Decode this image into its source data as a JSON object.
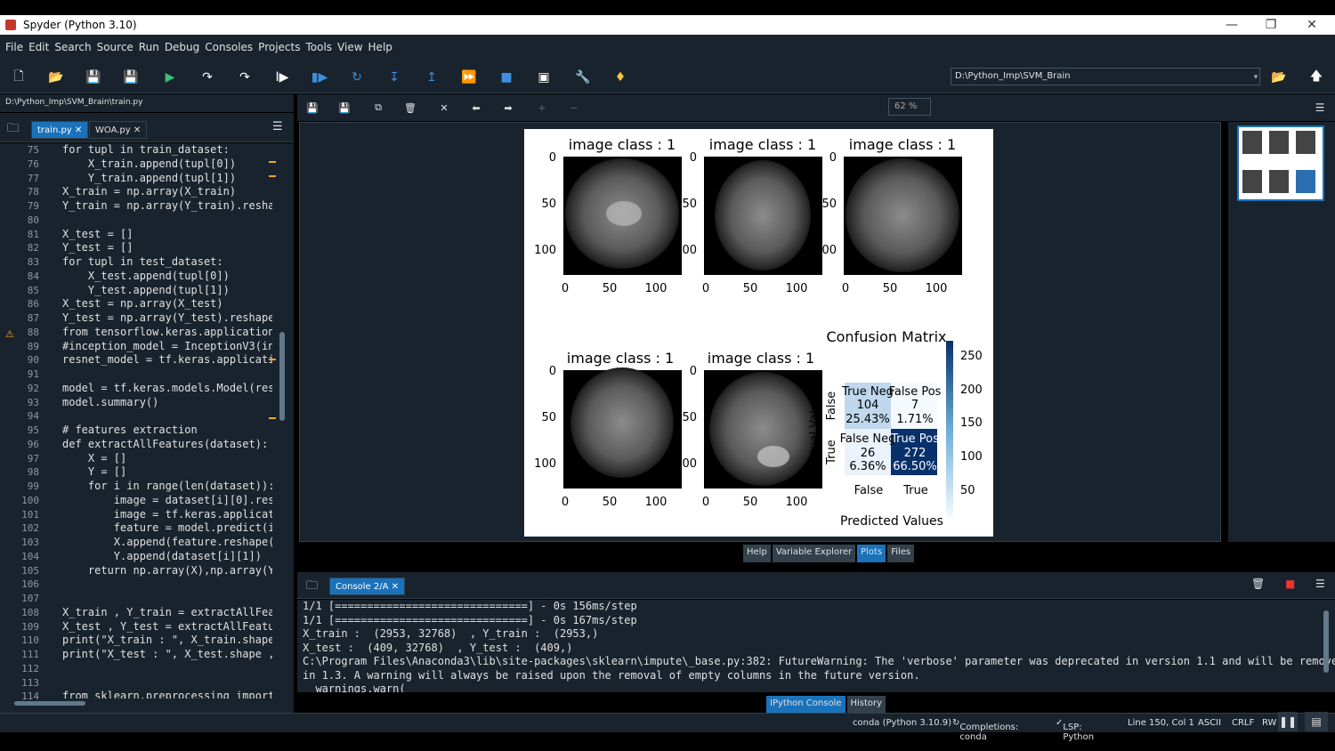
{
  "window": {
    "title": "Spyder (Python 3.10)"
  },
  "menu": [
    "File",
    "Edit",
    "Search",
    "Source",
    "Run",
    "Debug",
    "Consoles",
    "Projects",
    "Tools",
    "View",
    "Help"
  ],
  "toolbar": {
    "path": "D:\\Python_Imp\\SVM_Brain"
  },
  "editor": {
    "path": "D:\\Python_Imp\\SVM_Brain\\train.py",
    "tabs": [
      "train.py",
      "WOA.py"
    ],
    "line_start": 75,
    "lines": [
      "for tupl in train_dataset:",
      "    X_train.append(tupl[0])",
      "    Y_train.append(tupl[1])",
      "X_train = np.array(X_train)",
      "Y_train = np.array(Y_train).resha",
      "",
      "X_test = []",
      "Y_test = []",
      "for tupl in test_dataset:",
      "    X_test.append(tupl[0])",
      "    Y_test.append(tupl[1])",
      "X_test = np.array(X_test)",
      "Y_test = np.array(Y_test).reshape",
      "from tensorflow.keras.application",
      "#inception_model = InceptionV3(in",
      "resnet_model = tf.keras.applicati",
      "",
      "model = tf.keras.models.Model(res",
      "model.summary()",
      "",
      "# features extraction",
      "def extractAllFeatures(dataset):",
      "    X = []",
      "    Y = []",
      "    for i in range(len(dataset)):",
      "        image = dataset[i][0].res",
      "        image = tf.keras.applicat",
      "        feature = model.predict(i",
      "        X.append(feature.reshape(",
      "        Y.append(dataset[i][1])",
      "    return np.array(X),np.array(Y",
      "",
      "",
      "X_train , Y_train = extractAllFea",
      "X_test , Y_test = extractAllFeatu",
      "print(\"X_train : \", X_train.shape",
      "print(\"X_test : \", X_test.shape ,",
      "",
      "",
      "from sklearn.preprocessing import"
    ]
  },
  "plots": {
    "zoom": "62 %",
    "image_titles": [
      "image class : 1",
      "image class : 1",
      "image class : 1",
      "image class : 1",
      "image class : 1"
    ],
    "x_ticks": [
      "0",
      "50",
      "100"
    ],
    "y_ticks": [
      "0",
      "50",
      "100"
    ],
    "y_ticks_clipped": [
      "0",
      "50",
      "00"
    ],
    "cm_title": "Confusion Matrix",
    "cm_cells": [
      {
        "name": "True Neg",
        "count": "104",
        "pct": "25.43%"
      },
      {
        "name": "False Pos",
        "count": "7",
        "pct": "1.71%"
      },
      {
        "name": "False Neg",
        "count": "26",
        "pct": "6.36%"
      },
      {
        "name": "True Pos",
        "count": "272",
        "pct": "66.50%"
      }
    ],
    "cm_x_ticks": [
      "False",
      "True"
    ],
    "cm_y_ticks": [
      "False",
      "True"
    ],
    "cm_xlabel": "Predicted Values",
    "cm_ylabel": "Actual Values",
    "colorbar_ticks": [
      "250",
      "200",
      "150",
      "100",
      "50"
    ]
  },
  "pane_tabs": [
    "Help",
    "Variable Explorer",
    "Plots",
    "Files"
  ],
  "console": {
    "tab": "Console 2/A",
    "lines": [
      "1/1 [==============================] - 0s 156ms/step",
      "1/1 [==============================] - 0s 167ms/step",
      "X_train :  (2953, 32768)  , Y_train :  (2953,)",
      "X_test :  (409, 32768)  , Y_test :  (409,)",
      "C:\\Program Files\\Anaconda3\\lib\\site-packages\\sklearn\\impute\\_base.py:382: FutureWarning: The 'verbose' parameter was deprecated in version 1.1 and will be removed",
      "in 1.3. A warning will always be raised upon the removal of empty columns in the future version.",
      "  warnings.warn("
    ],
    "bottom_tabs": [
      "IPython Console",
      "History"
    ]
  },
  "status": {
    "env": "conda (Python 3.10.9)",
    "completions": "Completions: conda",
    "lsp": "LSP: Python",
    "position": "Line 150, Col 1",
    "encoding": "ASCII",
    "eol": "CRLF",
    "rw": "RW"
  }
}
